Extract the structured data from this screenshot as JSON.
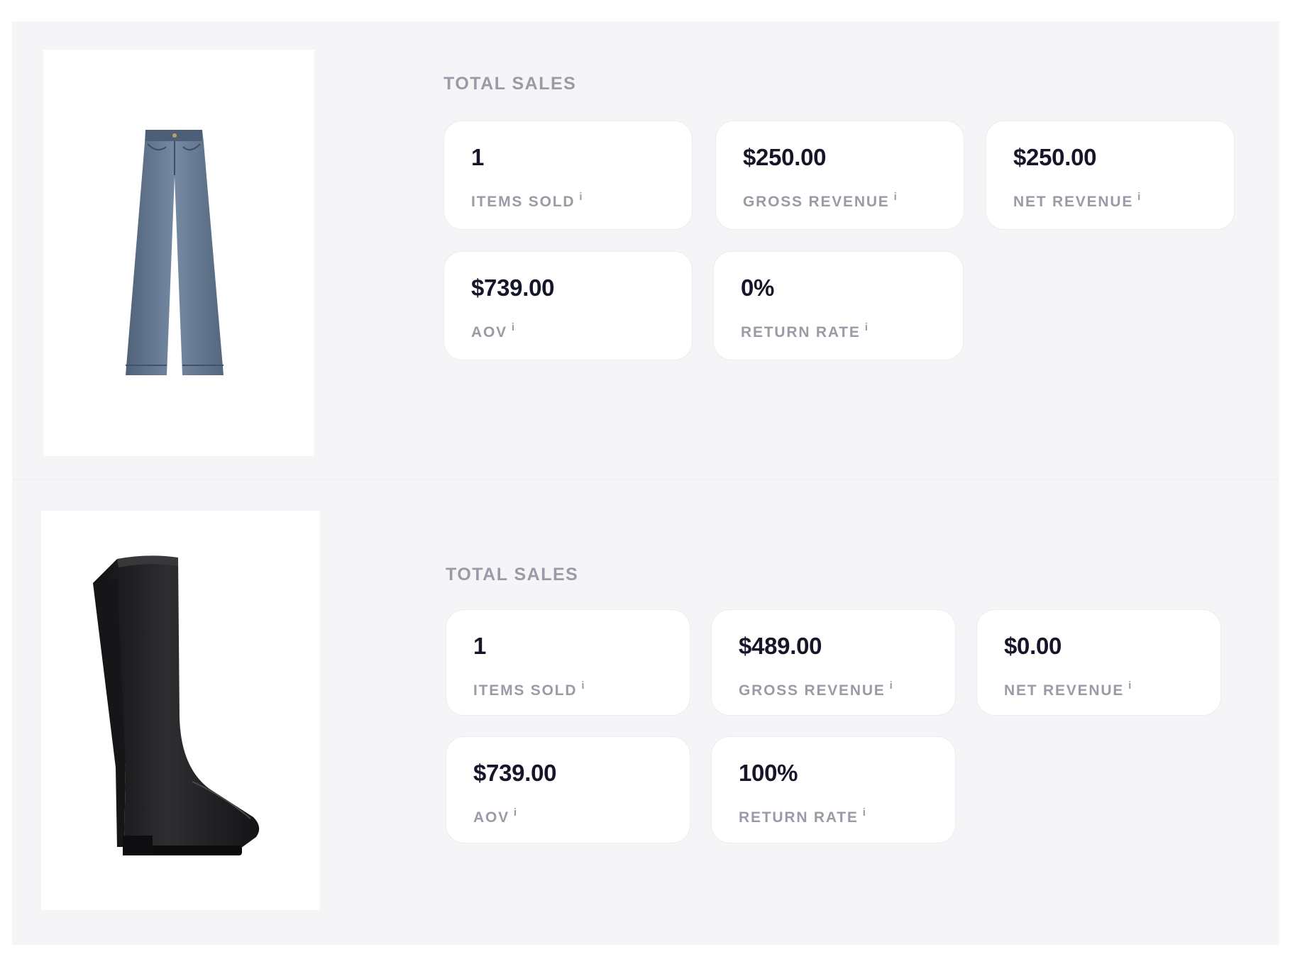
{
  "products": [
    {
      "image_icon": "jeans-icon",
      "section_title": "TOTAL SALES",
      "metrics": [
        {
          "value": "1",
          "label": "ITEMS SOLD",
          "info": "i"
        },
        {
          "value": "$250.00",
          "label": "GROSS REVENUE",
          "info": "i"
        },
        {
          "value": "$250.00",
          "label": "NET REVENUE",
          "info": "i"
        },
        {
          "value": "$739.00",
          "label": "AOV",
          "info": "i"
        },
        {
          "value": "0%",
          "label": "RETURN RATE",
          "info": "i"
        }
      ]
    },
    {
      "image_icon": "boot-icon",
      "section_title": "TOTAL SALES",
      "metrics": [
        {
          "value": "1",
          "label": "ITEMS SOLD",
          "info": "i"
        },
        {
          "value": "$489.00",
          "label": "GROSS REVENUE",
          "info": "i"
        },
        {
          "value": "$0.00",
          "label": "NET REVENUE",
          "info": "i"
        },
        {
          "value": "$739.00",
          "label": "AOV",
          "info": "i"
        },
        {
          "value": "100%",
          "label": "RETURN RATE",
          "info": "i"
        }
      ]
    }
  ],
  "colors": {
    "page_bg": "#f5f5f7",
    "card_bg": "#ffffff",
    "value_text": "#16162a",
    "label_text": "#9b9ba8",
    "denim": "#5f7590",
    "leather": "#1e1e20"
  }
}
